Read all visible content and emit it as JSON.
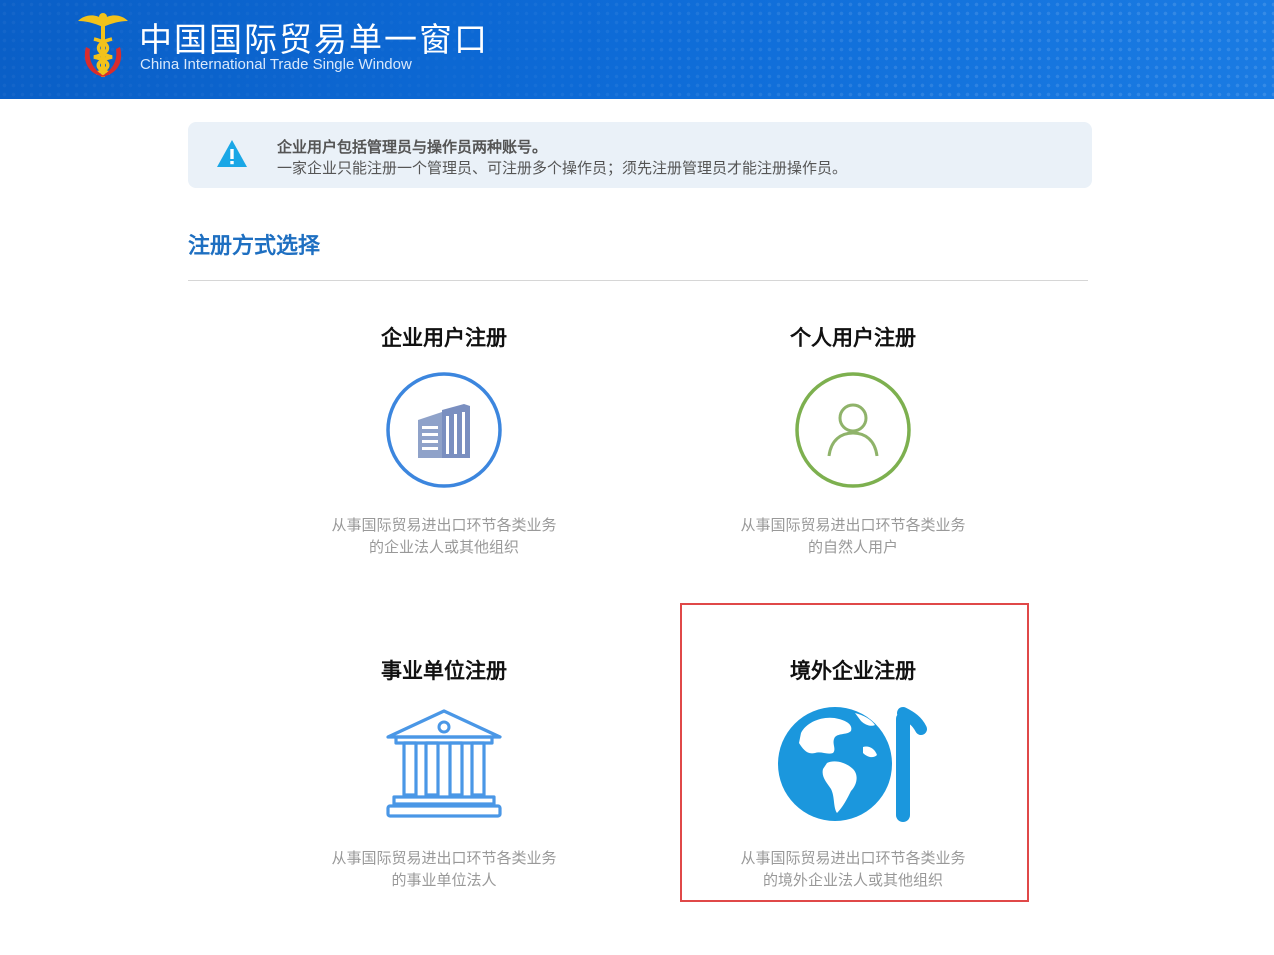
{
  "header": {
    "title_cn": "中国国际贸易单一窗口",
    "title_en": "China International Trade Single  Window",
    "logo_icon": "customs-emblem-icon"
  },
  "notice": {
    "icon": "warning-triangle-icon",
    "line1": "企业用户包括管理员与操作员两种账号。",
    "line2": "一家企业只能注册一个管理员、可注册多个操作员；须先注册管理员才能注册操作员。"
  },
  "section_title": "注册方式选择",
  "cards": [
    {
      "title": "企业用户注册",
      "icon": "building-icon",
      "desc1": "从事国际贸易进出口环节各类业务",
      "desc2": "的企业法人或其他组织",
      "color": "#3c86de"
    },
    {
      "title": "个人用户注册",
      "icon": "person-icon",
      "desc1": "从事国际贸易进出口环节各类业务",
      "desc2": "的自然人用户",
      "color": "#7db04f"
    },
    {
      "title": "事业单位注册",
      "icon": "institution-icon",
      "desc1": "从事国际贸易进出口环节各类业务",
      "desc2": "的事业单位法人",
      "color": "#4a97e6"
    },
    {
      "title": "境外企业注册",
      "icon": "globe-icon",
      "desc1": "从事国际贸易进出口环节各类业务",
      "desc2": "的境外企业法人或其他组织",
      "color": "#1b97dd"
    }
  ],
  "highlight_color": "#e04848"
}
